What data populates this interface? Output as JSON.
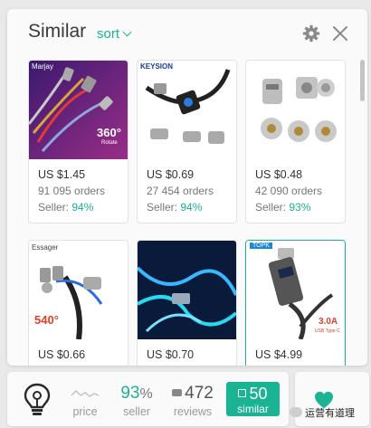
{
  "header": {
    "title": "Similar",
    "sort_label": "sort"
  },
  "products": [
    {
      "price": "US $1.45",
      "orders": "91 095 orders",
      "seller_label": "Seller:",
      "seller_pct": "94%",
      "brand": "Marjay",
      "badge_big": "360°",
      "badge_small": "Rotate"
    },
    {
      "price": "US $0.69",
      "orders": "27 454 orders",
      "seller_label": "Seller:",
      "seller_pct": "94%",
      "brand": "KEYSION"
    },
    {
      "price": "US $0.48",
      "orders": "42 090 orders",
      "seller_label": "Seller:",
      "seller_pct": "93%"
    },
    {
      "price": "US $0.66",
      "brand": "Essager",
      "badge_big": "540°"
    },
    {
      "price": "US $0.70"
    },
    {
      "price": "US $4.99",
      "brand": "TOPK",
      "badge_big": "3.0A",
      "badge_small": "USB Type-C"
    }
  ],
  "stats": {
    "price_label": "price",
    "seller_value": "93",
    "seller_unit": "%",
    "seller_label": "seller",
    "reviews_value": "472",
    "reviews_label": "reviews",
    "similar_value": "50",
    "similar_label": "similar"
  },
  "watermark": "运营有道理",
  "colors": {
    "accent": "#1ab394"
  }
}
